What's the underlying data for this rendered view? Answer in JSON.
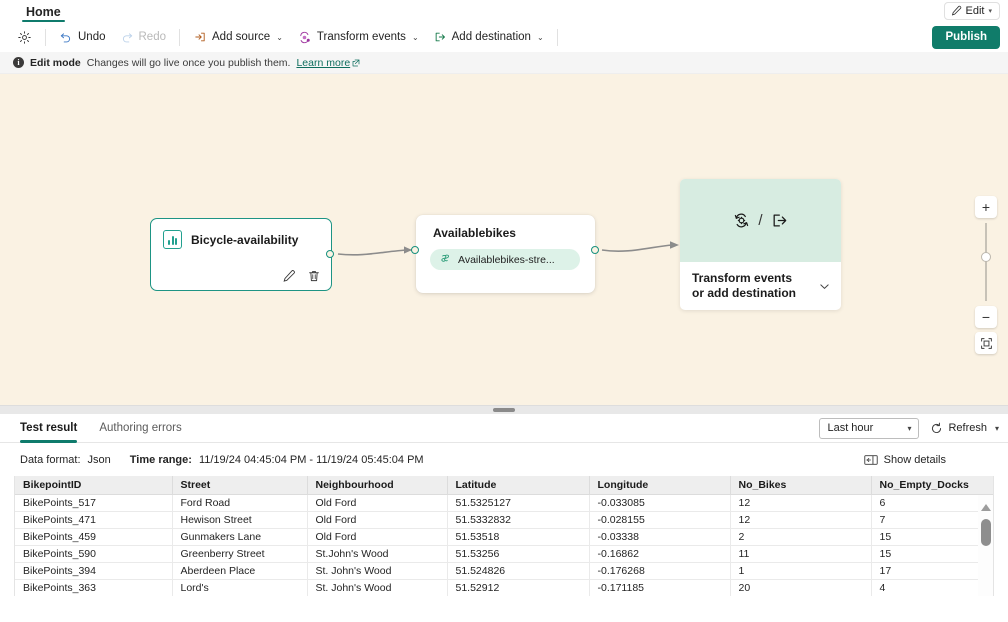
{
  "tabstrip": {
    "home_label": "Home",
    "edit_label": "Edit",
    "edit_icon": "pencil-icon",
    "caret": "▾"
  },
  "toolbar": {
    "settings_icon": "gear-icon",
    "undo_label": "Undo",
    "redo_label": "Redo",
    "add_source_label": "Add source",
    "transform_events_label": "Transform events",
    "add_destination_label": "Add destination",
    "publish_label": "Publish",
    "caret": "⌄",
    "publish_color": "#107c6a"
  },
  "notice": {
    "icon": "info-icon",
    "title": "Edit mode",
    "message": "Changes will go live once you publish them.",
    "link_label": "Learn more",
    "link_icon": "external-link-icon"
  },
  "canvas": {
    "background_color": "#faf2e3",
    "source_node": {
      "title": "Bicycle-availability",
      "icon": "bar-chart-icon",
      "edit_icon": "pencil-icon",
      "delete_icon": "trash-icon",
      "border_color": "#1d9484"
    },
    "stream_node": {
      "title": "Availablebikes",
      "chip_label": "Availablebikes-stre...",
      "chip_icon": "stream-icon",
      "chip_color": "#ddf2e8"
    },
    "add_node": {
      "transform_icon": "transform-events-icon",
      "separator": "/",
      "destination_icon": "add-destination-icon",
      "label": "Transform events or add destination",
      "chevron": "⌄",
      "header_color": "#d7ece1"
    },
    "zoom_controls": {
      "zoom_in": "+",
      "zoom_out": "−",
      "fit_to_screen": "fit-to-screen-icon"
    }
  },
  "bottom_panel": {
    "tabs": [
      {
        "label": "Test result",
        "active": true
      },
      {
        "label": "Authoring errors",
        "active": false
      }
    ],
    "time_range_selected": "Last hour",
    "refresh_label": "Refresh",
    "refresh_icon": "refresh-icon",
    "meta": {
      "data_format_label": "Data format:",
      "data_format_value": "Json",
      "time_range_label": "Time range:",
      "time_range_value": "11/19/24 04:45:04 PM - 11/19/24 05:45:04 PM"
    },
    "show_details_label": "Show details",
    "show_details_icon": "details-panel-icon",
    "table": {
      "columns": [
        "BikepointID",
        "Street",
        "Neighbourhood",
        "Latitude",
        "Longitude",
        "No_Bikes",
        "No_Empty_Docks"
      ],
      "rows": [
        [
          "BikePoints_517",
          "Ford Road",
          "Old Ford",
          "51.5325127",
          "-0.033085",
          "12",
          "6"
        ],
        [
          "BikePoints_471",
          "Hewison Street",
          "Old Ford",
          "51.5332832",
          "-0.028155",
          "12",
          "7"
        ],
        [
          "BikePoints_459",
          "Gunmakers Lane",
          "Old Ford",
          "51.53518",
          "-0.03338",
          "2",
          "15"
        ],
        [
          "BikePoints_590",
          "Greenberry Street",
          "St.John's Wood",
          "51.53256",
          "-0.16862",
          "11",
          "15"
        ],
        [
          "BikePoints_394",
          "Aberdeen Place",
          "St. John's Wood",
          "51.524826",
          "-0.176268",
          "1",
          "17"
        ],
        [
          "BikePoints_363",
          "Lord's",
          "St. John's Wood",
          "51.52912",
          "-0.171185",
          "20",
          "4"
        ]
      ]
    }
  }
}
